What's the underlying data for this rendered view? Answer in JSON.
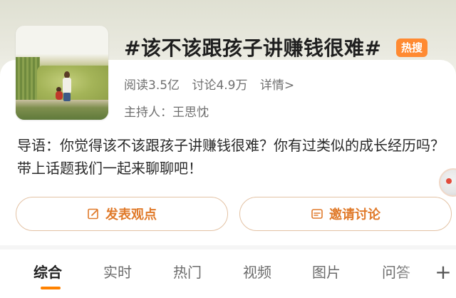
{
  "topic": {
    "title": "#该不该跟孩子讲赚钱很难#",
    "badge": "热搜",
    "reads": "阅读3.5亿",
    "discussions": "讨论4.9万",
    "details": "详情>",
    "host": "主持人：王思忱"
  },
  "intro": "导语：你觉得该不该跟孩子讲赚钱很难？你有过类似的成长经历吗？带上话题我们一起来聊聊吧！",
  "actions": {
    "post_label": "发表观点",
    "invite_label": "邀请讨论"
  },
  "tabs": [
    {
      "label": "综合"
    },
    {
      "label": "实时"
    },
    {
      "label": "热门"
    },
    {
      "label": "视频"
    },
    {
      "label": "图片"
    },
    {
      "label": "问答"
    }
  ],
  "more_tabs": "+",
  "colors": {
    "accent": "#ff8200",
    "badge_bg": "#ff8a32",
    "button_text": "#e07a2a",
    "button_border": "#e3c2a4"
  },
  "icons": {
    "post": "edit-icon",
    "invite": "invite-message-icon"
  }
}
